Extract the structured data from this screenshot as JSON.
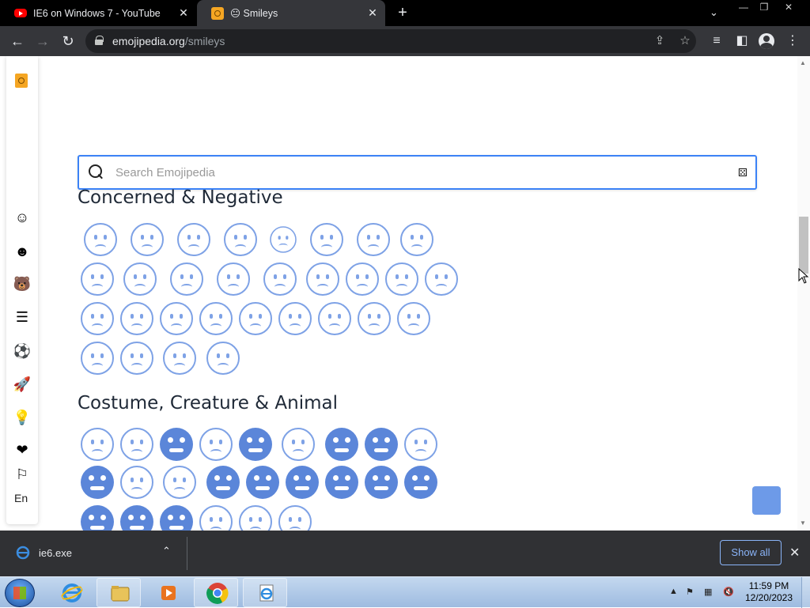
{
  "browser": {
    "tabs": [
      {
        "title": "IE6 on Windows 7 - YouTube",
        "icon": "youtube-icon",
        "active": false
      },
      {
        "title": "😐 Smileys",
        "icon": "emojipedia-icon",
        "active": true
      }
    ],
    "address": {
      "domain": "emojipedia.org",
      "path": "/smileys"
    }
  },
  "sidebar": {
    "items": [
      {
        "name": "smileys",
        "glyph": "☺"
      },
      {
        "name": "people",
        "glyph": "☻"
      },
      {
        "name": "animals",
        "glyph": "🐻"
      },
      {
        "name": "food",
        "glyph": "☰"
      },
      {
        "name": "activities",
        "glyph": "⚽"
      },
      {
        "name": "travel",
        "glyph": "🚀"
      },
      {
        "name": "objects",
        "glyph": "💡"
      },
      {
        "name": "symbols",
        "glyph": "❤"
      },
      {
        "name": "flags",
        "glyph": "⚐"
      }
    ],
    "language": "En"
  },
  "search": {
    "placeholder": "Search Emojipedia"
  },
  "sections": [
    {
      "title": "Concerned & Negative"
    },
    {
      "title": "Costume, Creature & Animal"
    }
  ],
  "downloads": {
    "file": "ie6.exe",
    "show_all": "Show all"
  },
  "taskbar": {
    "time": "11:59 PM",
    "date": "12/20/2023"
  },
  "colors": {
    "accent": "#3b82f6",
    "emoji_blue": "#5b86d9"
  }
}
